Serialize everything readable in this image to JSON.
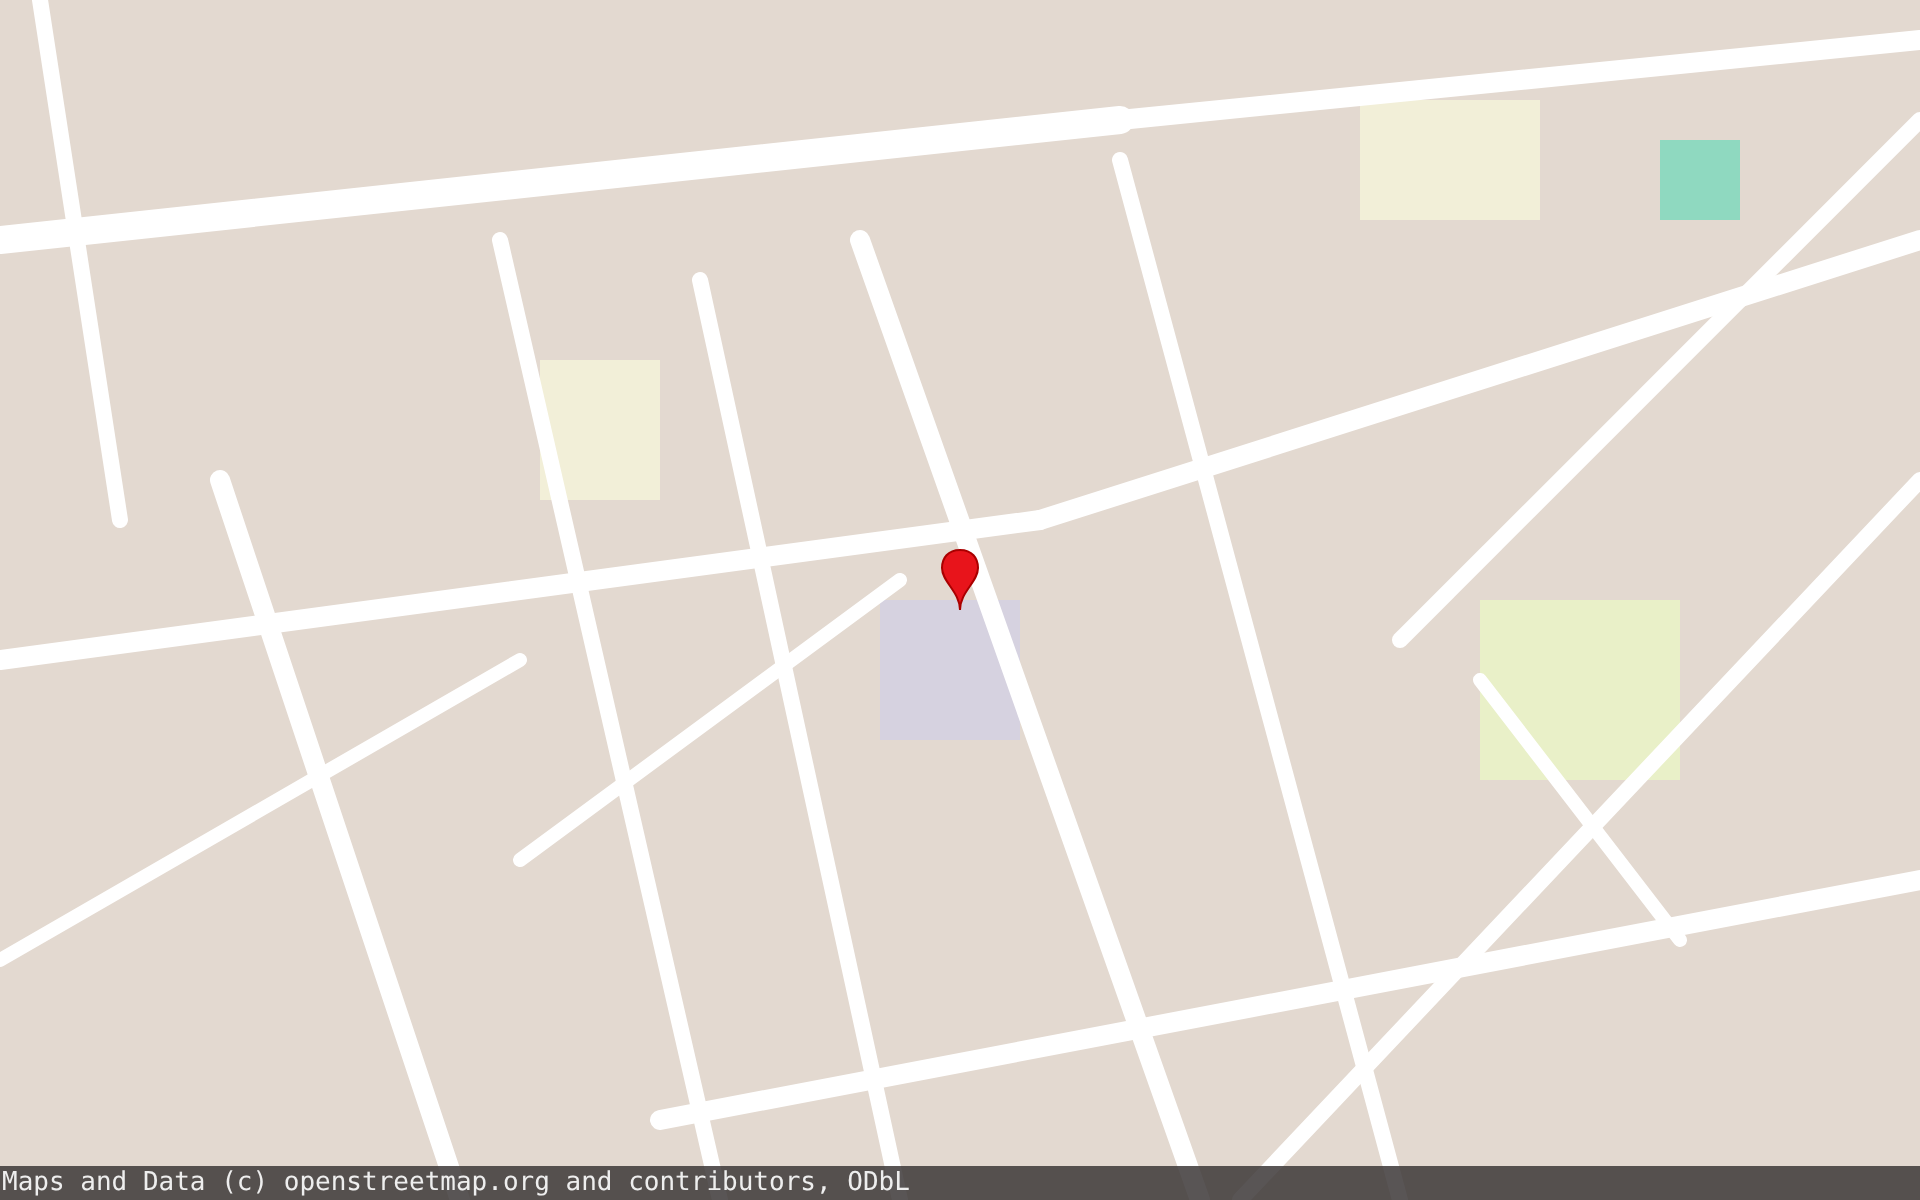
{
  "map": {
    "marker": {
      "shown": true
    }
  },
  "attribution": "Maps and Data (c) openstreetmap.org and contributors, ODbL"
}
